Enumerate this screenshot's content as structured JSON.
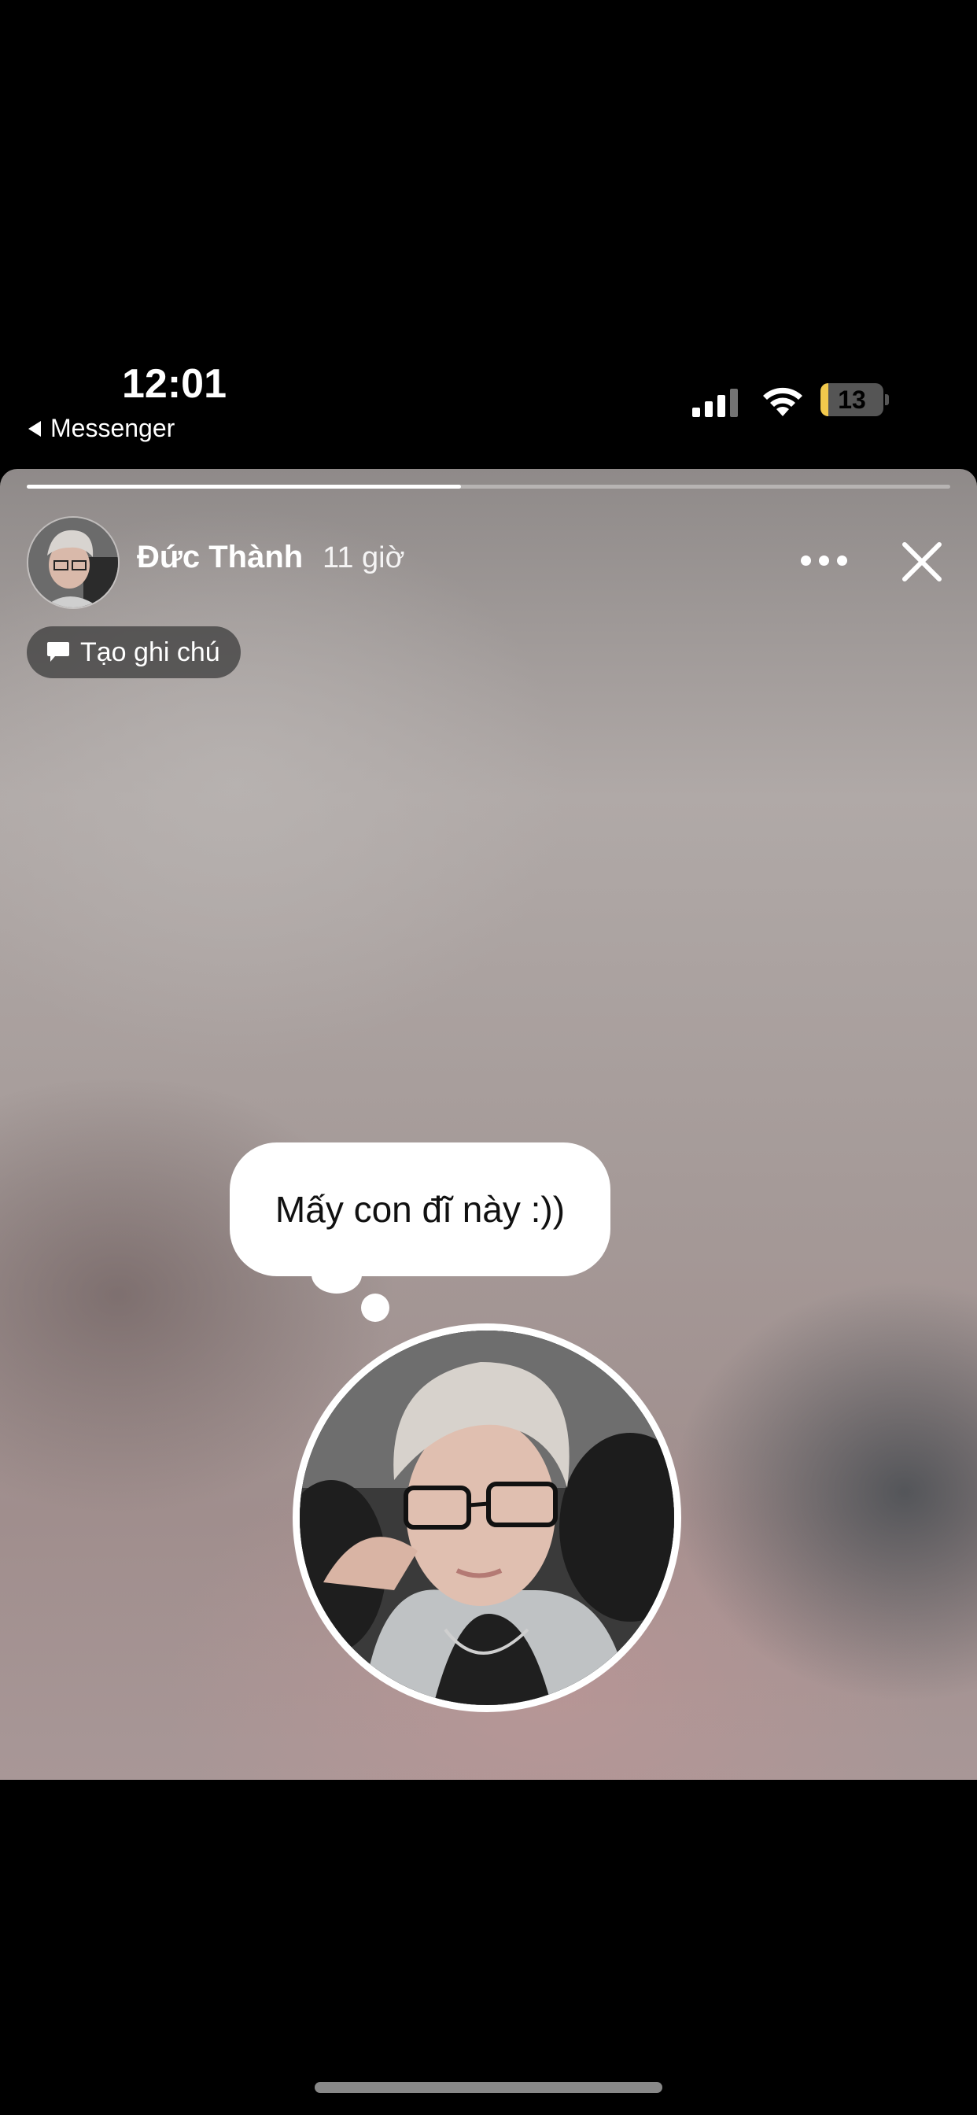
{
  "status_bar": {
    "time": "12:01",
    "back_app": "Messenger",
    "battery_level": "13",
    "battery_fraction": 0.13
  },
  "story": {
    "progress_fraction": 0.47,
    "user_name": "Đức Thành",
    "post_time": "11 giờ",
    "note_button_label": "Tạo ghi chú",
    "note_text": "Mấy con đĩ này :))"
  },
  "icons": {
    "more": "more-dots-icon",
    "close": "close-icon",
    "note": "speech-bubble-icon"
  }
}
